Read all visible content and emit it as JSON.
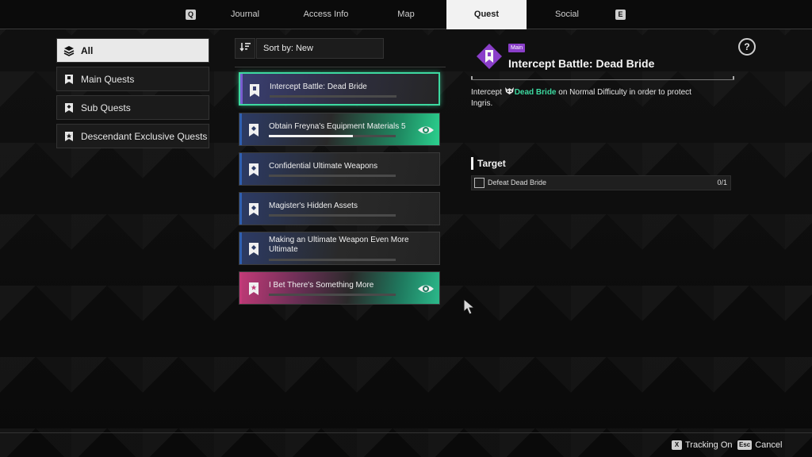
{
  "nav": {
    "key_left": "Q",
    "key_right": "E",
    "tabs": [
      {
        "label": "Journal"
      },
      {
        "label": "Access Info"
      },
      {
        "label": "Map"
      },
      {
        "label": "Quest",
        "active": true
      },
      {
        "label": "Social"
      }
    ]
  },
  "filters": [
    {
      "label": "All",
      "active": true,
      "icon": "layers-icon"
    },
    {
      "label": "Main Quests",
      "icon": "bookmark-icon"
    },
    {
      "label": "Sub Quests",
      "icon": "bookmark-diamond-icon"
    },
    {
      "label": "Descendant Exclusive Quests",
      "icon": "bookmark-star-icon"
    }
  ],
  "sort": {
    "label": "Sort by: New",
    "icon": "sort-icon"
  },
  "quests": [
    {
      "name": "Intercept Battle: Dead Bride",
      "progress": 0.0,
      "selected": true,
      "type": "main",
      "tracked": false
    },
    {
      "name": "Obtain Freyna's Equipment Materials 5",
      "progress": 0.66,
      "type": "sub",
      "tracked": true
    },
    {
      "name": "Confidential Ultimate Weapons",
      "progress": 0.0,
      "type": "sub",
      "tracked": false
    },
    {
      "name": "Magister's Hidden Assets",
      "progress": 0.0,
      "type": "sub",
      "tracked": false
    },
    {
      "name": "Making an Ultimate Weapon Even More Ultimate",
      "progress": 0.0,
      "type": "sub",
      "tracked": false
    },
    {
      "name": "I Bet There's Something More",
      "progress": 0.0,
      "type": "descendant",
      "tracked": true
    }
  ],
  "detail": {
    "tag": "Main",
    "title": "Intercept Battle: Dead Bride",
    "desc_prefix": "Intercept ",
    "desc_highlight": "Dead Bride",
    "desc_suffix": " on Normal Difficulty in order to protect Ingris.",
    "target_heading": "Target",
    "targets": [
      {
        "name": "Defeat Dead Bride",
        "count": "0/1"
      }
    ],
    "help": "?"
  },
  "bottom": {
    "tracking_key": "X",
    "tracking_label": "Tracking On",
    "cancel_key": "Esc",
    "cancel_label": "Cancel"
  },
  "colors": {
    "accent_green": "#3dd9a0",
    "main_purple": "#8a3ec9",
    "sub_blue": "#2f5fb0",
    "descendant_pink": "#c23a78"
  }
}
